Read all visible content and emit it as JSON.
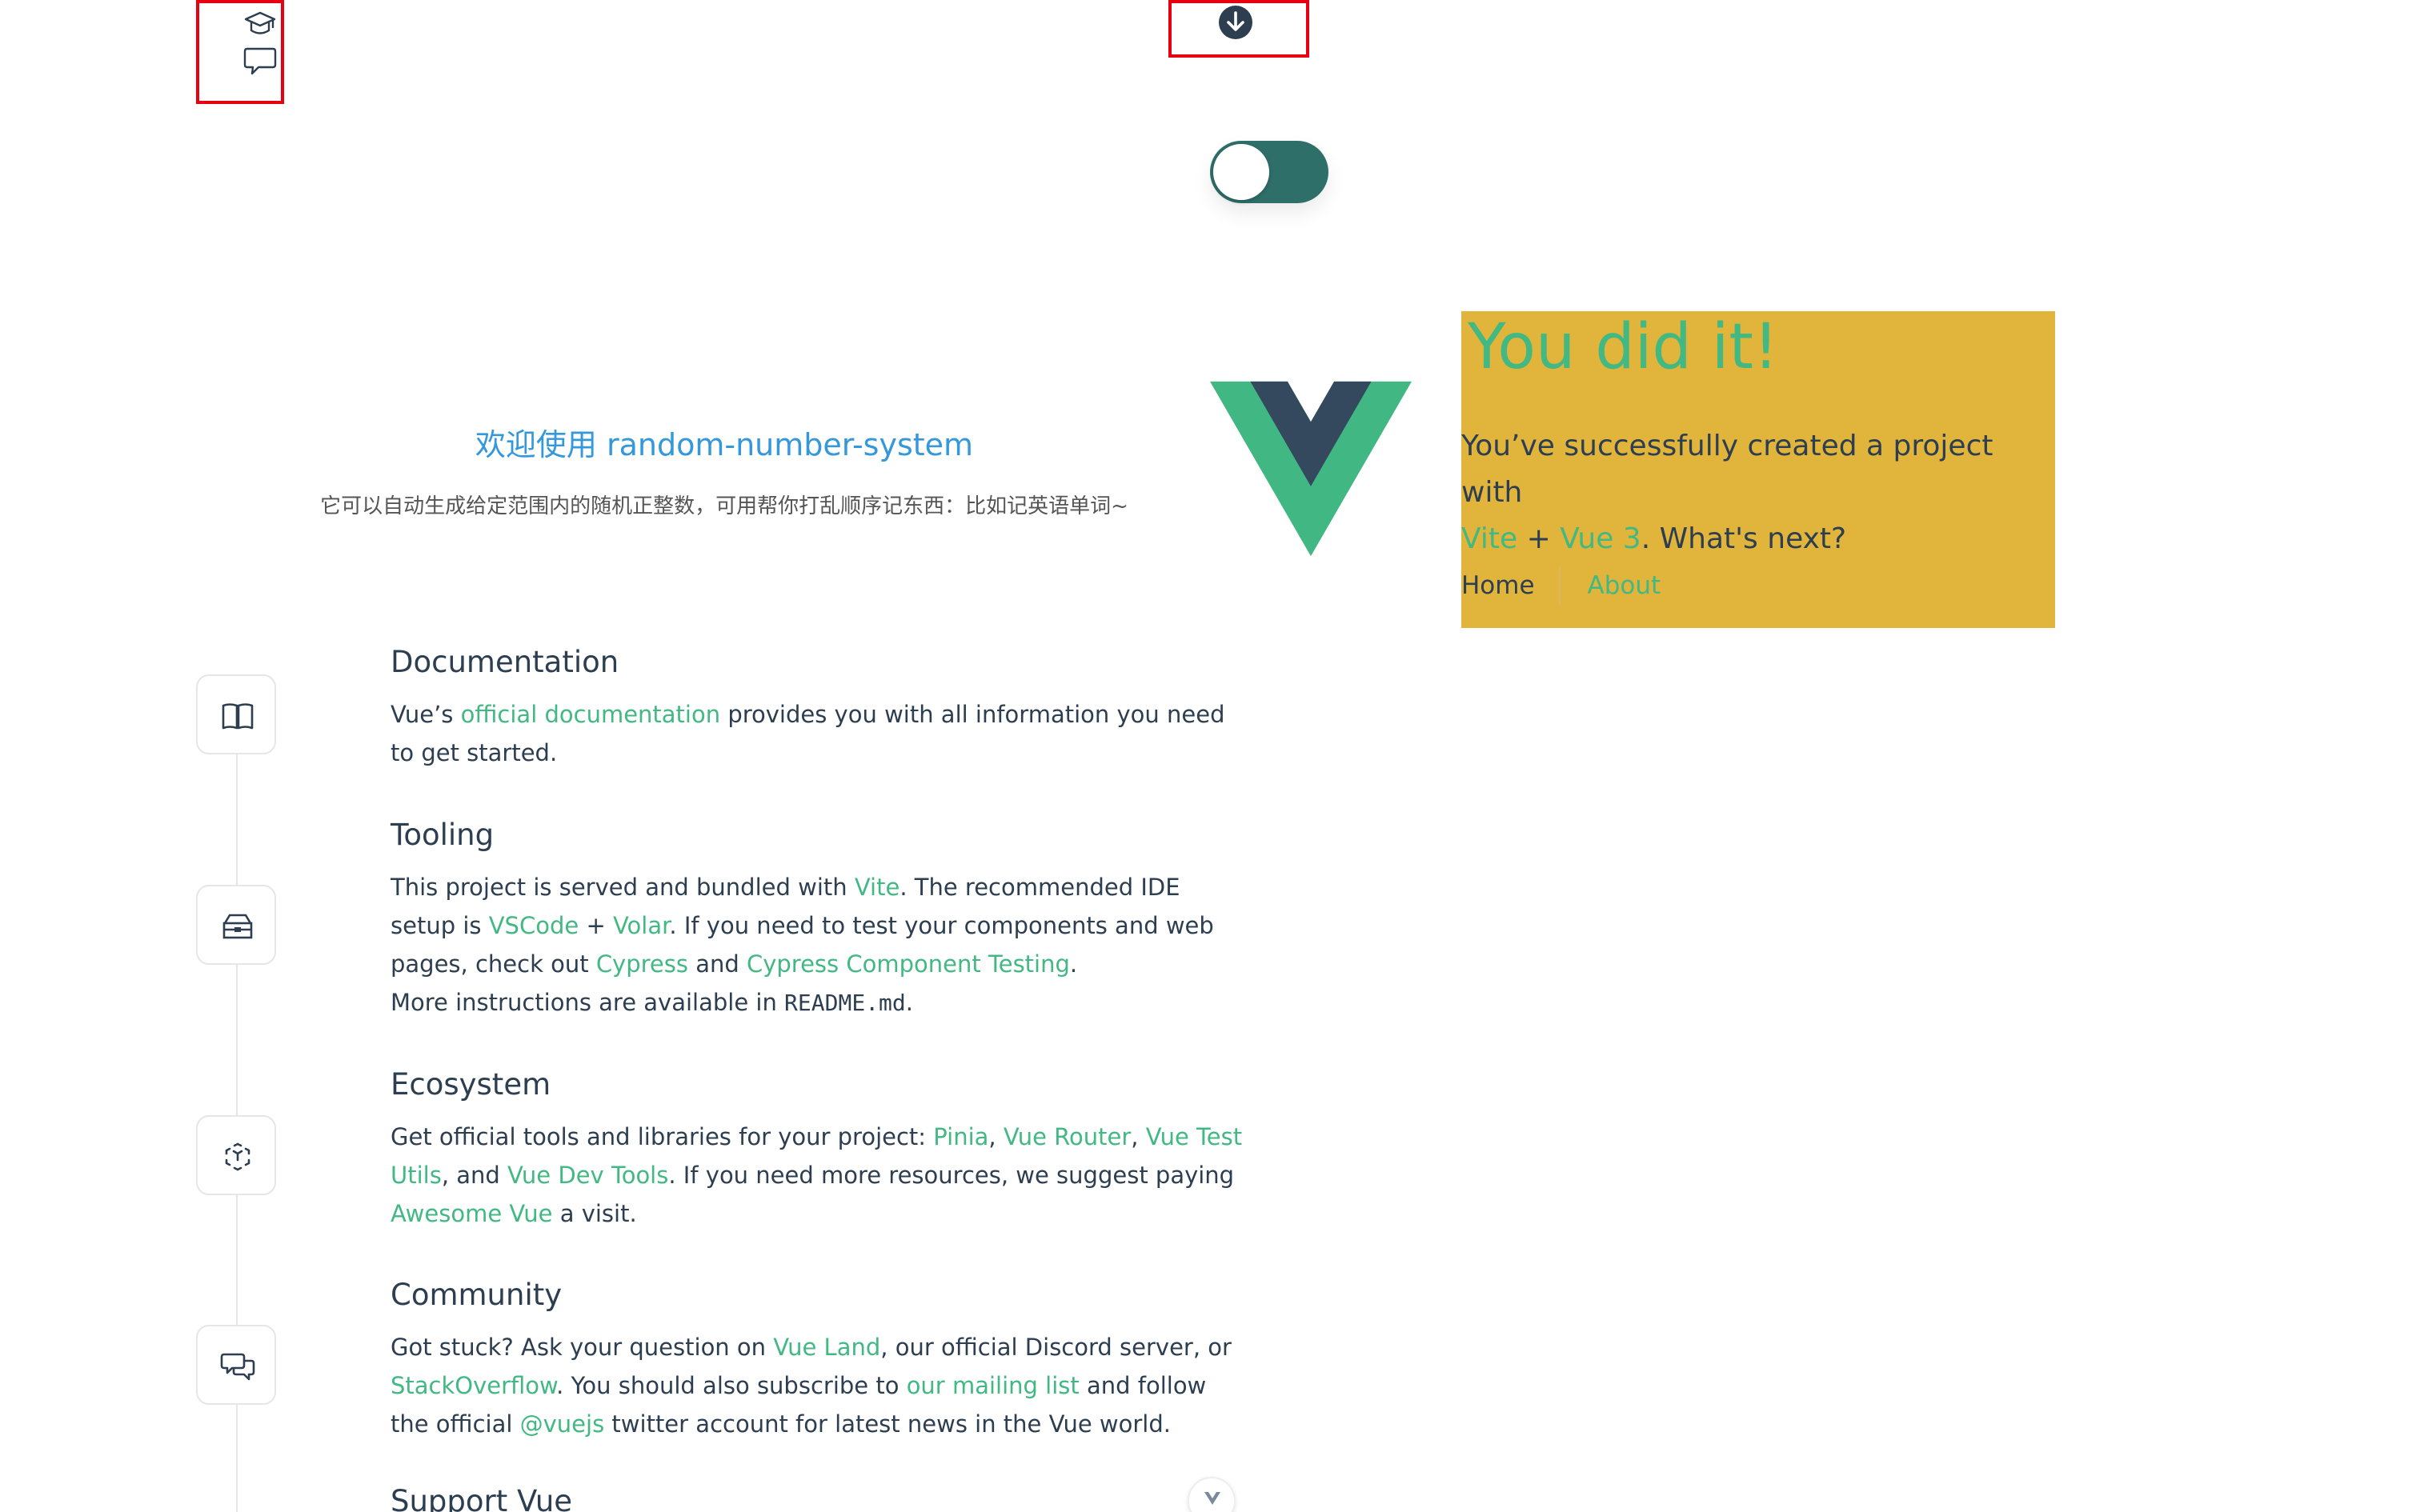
{
  "toolbar": {
    "icons": [
      "graduation-cap-icon",
      "chat-bubble-icon",
      "download-arrow-icon"
    ],
    "toggle_state": "on"
  },
  "welcome": {
    "title": "欢迎使用 random-number-system",
    "subtitle": "它可以自动生成给定范围内的随机正整数，可用帮你打乱顺序记东西：比如记英语单词~"
  },
  "hero": {
    "heading": "You did it!",
    "text_before": "You’ve successfully created a project with",
    "link_vite": "Vite",
    "plus": "+",
    "link_vue3": "Vue 3",
    "text_after": ". What's next?",
    "nav": {
      "home": "Home",
      "about": "About"
    },
    "panel_color": "#e1b43b",
    "accent_color": "#42b883"
  },
  "sections": {
    "documentation": {
      "title": "Documentation",
      "t1": "Vue’s",
      "l1": "official documentation",
      "t2": "provides you with all information you need to get started."
    },
    "tooling": {
      "title": "Tooling",
      "t1": "This project is served and bundled with",
      "l1": "Vite",
      "t2": ". The recommended IDE setup is",
      "l2": "VSCode",
      "t3": "+",
      "l3": "Volar",
      "t4": ". If you need to test your components and web pages, check out",
      "l4": "Cypress",
      "t5": "and",
      "l5": "Cypress Component Testing",
      "t6": ".",
      "t7": "More instructions are available in",
      "code": "README.md",
      "t8": "."
    },
    "ecosystem": {
      "title": "Ecosystem",
      "t1": "Get official tools and libraries for your project:",
      "l1": "Pinia",
      "t2": ",",
      "l2": "Vue Router",
      "t3": ",",
      "l3": "Vue Test Utils",
      "t4": ", and",
      "l4": "Vue Dev Tools",
      "t5": ". If you need more resources, we suggest paying",
      "l5": "Awesome Vue",
      "t6": "a visit."
    },
    "community": {
      "title": "Community",
      "t1": "Got stuck? Ask your question on",
      "l1": "Vue Land",
      "t2": ", our official Discord server, or",
      "l2": "StackOverflow",
      "t3": ". You should also subscribe to",
      "l3": "our mailing list",
      "t4": "and follow the official",
      "l4": "@vuejs",
      "t5": "twitter account for latest news in the Vue world."
    },
    "support": {
      "title": "Support Vue"
    }
  },
  "icons": {
    "documentation": "book-icon",
    "tooling": "toolbox-icon",
    "ecosystem": "cube-icon",
    "community": "chat-bubbles-icon",
    "scroll": "chevron-down-icon"
  }
}
